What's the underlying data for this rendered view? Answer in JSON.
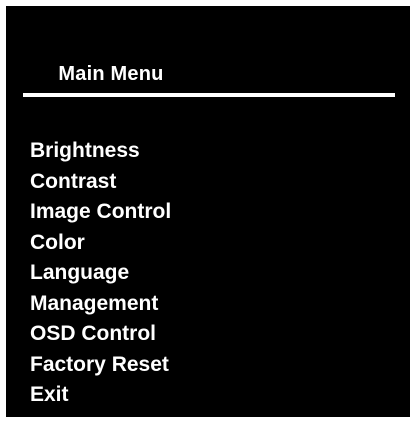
{
  "window": {
    "title": "Main Menu"
  },
  "menu": {
    "items": [
      {
        "label": "Brightness"
      },
      {
        "label": "Contrast"
      },
      {
        "label": "Image Control"
      },
      {
        "label": "Color"
      },
      {
        "label": "Language"
      },
      {
        "label": "Management"
      },
      {
        "label": "OSD Control"
      },
      {
        "label": "Factory Reset"
      },
      {
        "label": "Exit"
      }
    ]
  },
  "colors": {
    "background": "#000000",
    "text": "#FFFFFF",
    "divider": "#FFFFFF"
  }
}
